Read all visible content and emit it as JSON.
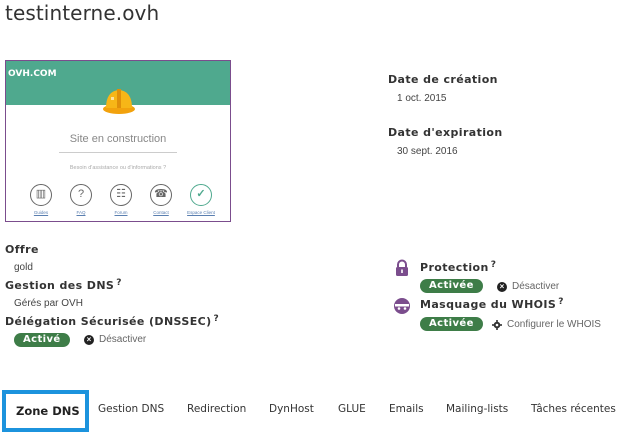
{
  "domain": {
    "name": "testinterne.ovh"
  },
  "preview": {
    "brand": "OVH.COM",
    "title": "Site en construction",
    "help": "Besoin d'assistance ou d'informations ?",
    "icons": [
      {
        "name": "guides-icon",
        "glyph": "▥",
        "label": "Guides"
      },
      {
        "name": "faq-icon",
        "glyph": "?",
        "label": "FAQ"
      },
      {
        "name": "forum-icon",
        "glyph": "☷",
        "label": "Forum"
      },
      {
        "name": "contact-icon",
        "glyph": "☎",
        "label": "Contact"
      },
      {
        "name": "espace-client-icon",
        "glyph": "✓",
        "label": "Espace Client"
      }
    ]
  },
  "dates": {
    "creation_label": "Date de création",
    "creation_value": "1 oct. 2015",
    "expiration_label": "Date d'expiration",
    "expiration_value": "30 sept. 2016"
  },
  "offer": {
    "label": "Offre",
    "value": "gold"
  },
  "dns_management": {
    "label": "Gestion des DNS",
    "help": "?",
    "value": "Gérés par OVH"
  },
  "dnssec": {
    "label": "Délégation Sécurisée (DNSSEC)",
    "help": "?",
    "status": "Activé",
    "action": "Désactiver"
  },
  "protection": {
    "label": "Protection",
    "help": "?",
    "status": "Activée",
    "action": "Désactiver"
  },
  "whois": {
    "label": "Masquage du WHOIS",
    "help": "?",
    "status": "Activée",
    "action": "Configurer le WHOIS"
  },
  "tabs": [
    {
      "label": "Zone DNS",
      "active": true
    },
    {
      "label": "Gestion DNS"
    },
    {
      "label": "Redirection"
    },
    {
      "label": "DynHost"
    },
    {
      "label": "GLUE"
    },
    {
      "label": "Emails"
    },
    {
      "label": "Mailing-lists"
    },
    {
      "label": "Tâches récentes"
    }
  ],
  "colors": {
    "badge": "#3e7d48",
    "active_tab_border": "#1c93dd",
    "icon_purple": "#7b4d8d",
    "preview_header": "#4fa98e"
  }
}
